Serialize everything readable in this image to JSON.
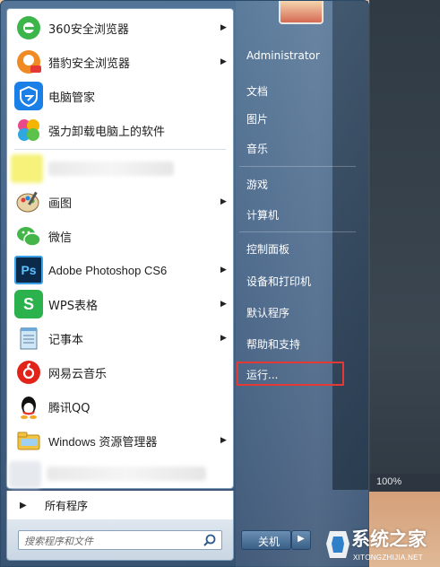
{
  "left_menu": {
    "items": [
      {
        "label": "360安全浏览器",
        "icon": "360-browser-icon",
        "has_submenu": true
      },
      {
        "label": "猎豹安全浏览器",
        "icon": "liebao-browser-icon",
        "has_submenu": true
      },
      {
        "label": "电脑管家",
        "icon": "pc-manager-icon",
        "has_submenu": false
      },
      {
        "label": "强力卸载电脑上的软件",
        "icon": "uninstaller-icon",
        "has_submenu": false
      },
      {
        "label": "画图",
        "icon": "paint-icon",
        "has_submenu": true
      },
      {
        "label": "微信",
        "icon": "wechat-icon",
        "has_submenu": false
      },
      {
        "label": "Adobe Photoshop CS6",
        "icon": "photoshop-icon",
        "has_submenu": true
      },
      {
        "label": "WPS表格",
        "icon": "wps-sheet-icon",
        "has_submenu": true
      },
      {
        "label": "记事本",
        "icon": "notepad-icon",
        "has_submenu": true
      },
      {
        "label": "网易云音乐",
        "icon": "netease-music-icon",
        "has_submenu": false
      },
      {
        "label": "腾讯QQ",
        "icon": "qq-icon",
        "has_submenu": false
      },
      {
        "label": "Windows 资源管理器",
        "icon": "explorer-icon",
        "has_submenu": true
      }
    ],
    "all_programs": "所有程序",
    "search_placeholder": "搜索程序和文件",
    "ps_icon_text": "Ps",
    "wps_icon_text": "S"
  },
  "right_menu": {
    "items": [
      "Administrator",
      "文档",
      "图片",
      "音乐",
      "游戏",
      "计算机",
      "控制面板",
      "设备和打印机",
      "默认程序",
      "帮助和支持",
      "运行..."
    ],
    "highlighted": "运行...",
    "shutdown": "关机"
  },
  "status": {
    "zoom": "100%"
  },
  "watermark": {
    "text": "系统之家",
    "sub": "XITONGZHIJIA.NET"
  },
  "colors": {
    "highlight_border": "#e53935",
    "menu_bg": "#3c5f87"
  }
}
